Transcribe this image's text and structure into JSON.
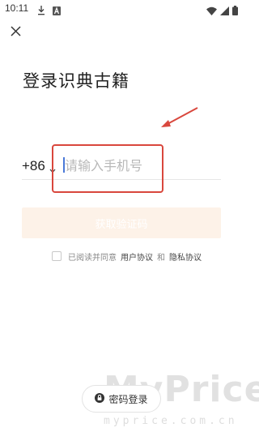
{
  "status_bar": {
    "time": "10:11",
    "icons": [
      "download-icon",
      "a-icon",
      "wifi-icon",
      "signal-icon",
      "battery-icon"
    ]
  },
  "page": {
    "close_icon": "close-icon",
    "title": "登录识典古籍"
  },
  "phone": {
    "country_code": "+86",
    "placeholder": "请输入手机号",
    "value": ""
  },
  "code_button": {
    "label": "获取验证码"
  },
  "agreement": {
    "prefix": "已阅读并同意",
    "user_agreement": "用户协议",
    "and": "和",
    "privacy_policy": "隐私协议"
  },
  "password_login": {
    "icon": "lock-icon",
    "label": "密码登录"
  },
  "watermark": {
    "main": "MyPrice",
    "sub": "myprice.com.cn"
  },
  "colors": {
    "annotation": "#d9473d",
    "button_bg": "#fdf2e8",
    "caret": "#4a79d8"
  }
}
